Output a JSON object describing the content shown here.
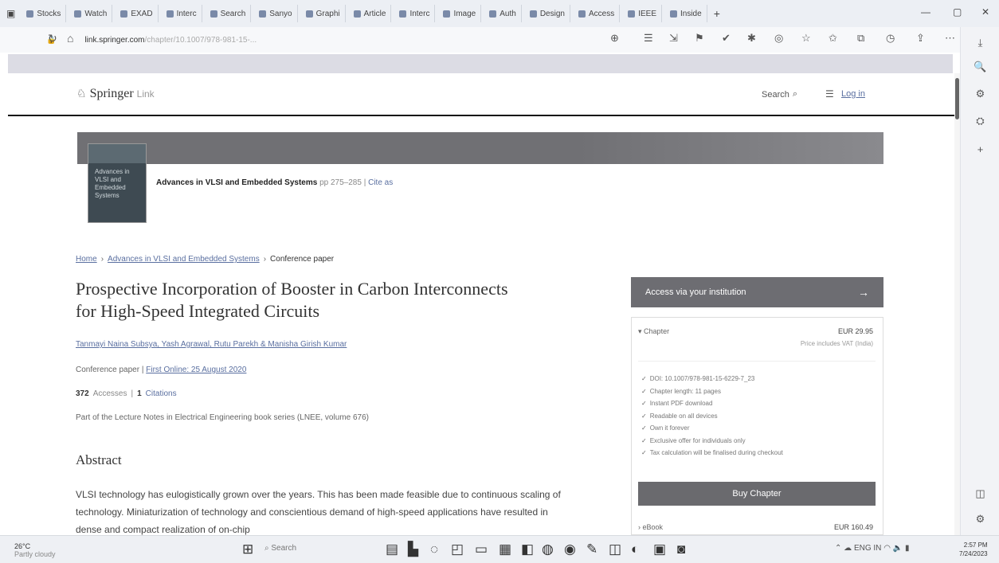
{
  "browser": {
    "tabs": [
      {
        "label": "Stocks"
      },
      {
        "label": "Watch"
      },
      {
        "label": "EXAD"
      },
      {
        "label": "Interc"
      },
      {
        "label": "Search"
      },
      {
        "label": "Sanyo"
      },
      {
        "label": "Graphi"
      },
      {
        "label": "Article"
      },
      {
        "label": "Interc"
      },
      {
        "label": "Image"
      },
      {
        "label": "Auth"
      },
      {
        "label": "Design"
      },
      {
        "label": "Access"
      },
      {
        "label": "IEEE"
      },
      {
        "label": "Inside"
      }
    ],
    "url_host": "link.springer.com",
    "url_path": "/chapter/10.1007/978-981-15-...",
    "window_controls": {
      "minimize": "—",
      "maximize": "▢",
      "close": "✕"
    }
  },
  "site": {
    "logo_name": "Springer",
    "logo_suffix": "Link",
    "search_label": "Search",
    "login_label": "Log in"
  },
  "book": {
    "cover_title": "Advances in VLSI and Embedded Systems",
    "title": "Advances in VLSI and Embedded Systems",
    "pages": "pp 275–285",
    "cite_label": "Cite as"
  },
  "breadcrumb": {
    "home": "Home",
    "book": "Advances in VLSI and Embedded Systems",
    "current": "Conference paper"
  },
  "article": {
    "title": "Prospective Incorporation of Booster in Carbon Interconnects for High-Speed Integrated Circuits",
    "authors": "Tanmayi Naina Subsya, Yash Agrawal, Rutu Parekh & Manisha Girish Kumar",
    "pub_type": "Conference paper",
    "first_online": "First Online: 25 August 2020",
    "accesses_count": "372",
    "accesses_label": "Accesses",
    "citations_count": "1",
    "citations_label": "Citations",
    "series": "Part of the Lecture Notes in Electrical Engineering book series (LNEE, volume 676)",
    "abstract_heading": "Abstract",
    "abstract_text": "VLSI technology has eulogistically grown over the years. This has been made feasible due to continuous scaling of technology. Miniaturization of technology and conscientious demand of high-speed applications have resulted in dense and compact realization of on-chip"
  },
  "purchase": {
    "access_label": "Access via your institution",
    "chapter_label": "Chapter",
    "chapter_price": "EUR 29.95",
    "price_note": "Price includes VAT (India)",
    "features": [
      "DOI: 10.1007/978-981-15-6229-7_23",
      "Chapter length: 11 pages",
      "Instant PDF download",
      "Readable on all devices",
      "Own it forever",
      "Exclusive offer for individuals only",
      "Tax calculation will be finalised during checkout"
    ],
    "buy_label": "Buy Chapter",
    "ebook_label": "eBook",
    "ebook_price": "EUR 160.49"
  },
  "taskbar": {
    "weather_temp": "26°C",
    "weather_desc": "Partly cloudy",
    "search_label": "Search",
    "tray_lang": "ENG",
    "tray_region": "IN",
    "clock_time": "2:57 PM",
    "clock_date": "7/24/2023"
  }
}
